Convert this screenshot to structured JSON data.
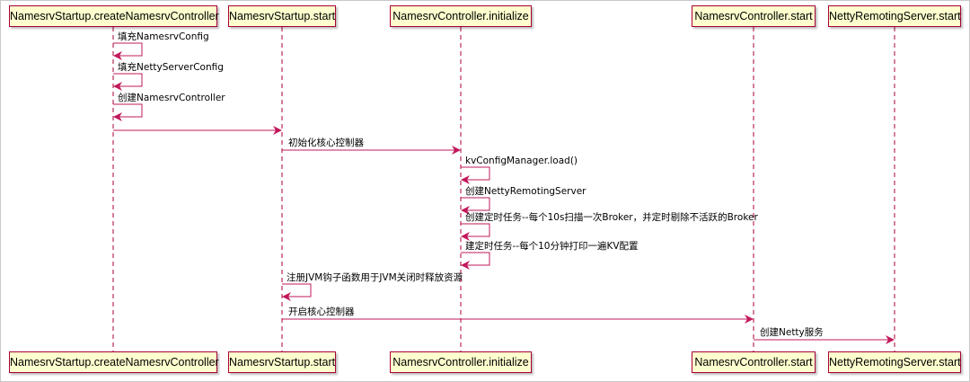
{
  "colors": {
    "line": "#a80036",
    "arrow": "#c2185b",
    "box_fill": "#fefece"
  },
  "participants": [
    "NamesrvStartup.createNamesrvController",
    "NamesrvStartup.start",
    "NamesrvController.initialize",
    "NamesrvController.start",
    "NettyRemotingServer.start"
  ],
  "messages": [
    {
      "from": 0,
      "to": 0,
      "label": "填充NamesrvConfig"
    },
    {
      "from": 0,
      "to": 0,
      "label": "填充NettyServerConfig"
    },
    {
      "from": 0,
      "to": 0,
      "label": "创建NamesrvController"
    },
    {
      "from": 0,
      "to": 1,
      "label": ""
    },
    {
      "from": 1,
      "to": 2,
      "label": "初始化核心控制器"
    },
    {
      "from": 2,
      "to": 2,
      "label": "kvConfigManager.load()"
    },
    {
      "from": 2,
      "to": 2,
      "label": "创建NettyRemotingServer"
    },
    {
      "from": 2,
      "to": 2,
      "label": "创建定时任务--每个10s扫描一次Broker，并定时剔除不活跃的Broker"
    },
    {
      "from": 2,
      "to": 2,
      "label": "建定时任务--每个10分钟打印一遍KV配置"
    },
    {
      "from": 1,
      "to": 1,
      "label": "注册JVM钩子函数用于JVM关闭时释放资源"
    },
    {
      "from": 1,
      "to": 3,
      "label": "开启核心控制器"
    },
    {
      "from": 3,
      "to": 4,
      "label": "创建Netty服务"
    }
  ]
}
